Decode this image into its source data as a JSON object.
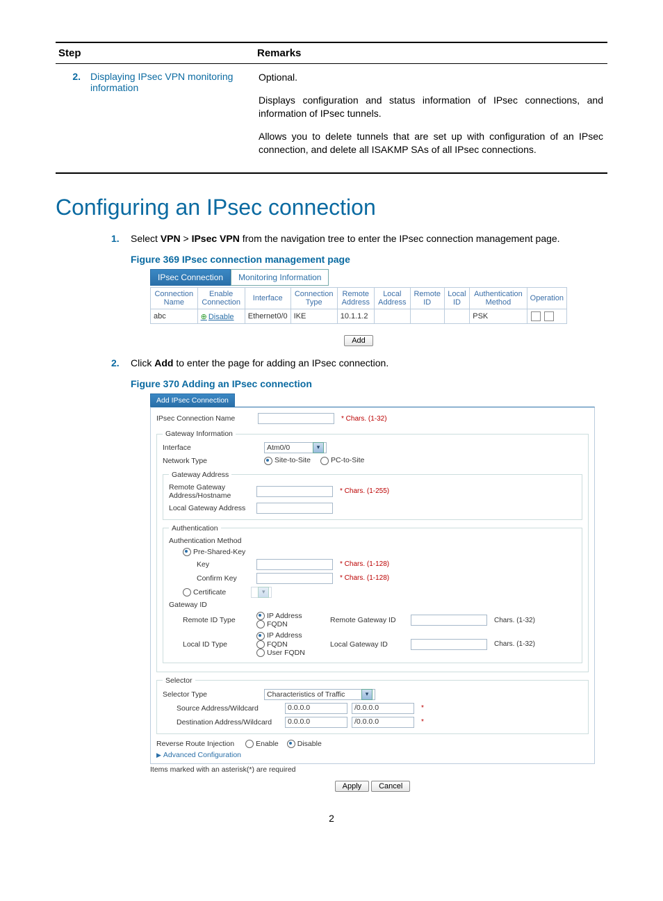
{
  "step_table": {
    "headers": [
      "Step",
      "Remarks"
    ],
    "row": {
      "num": "2.",
      "link_text": "Displaying IPsec VPN monitoring information",
      "remarks": [
        "Optional.",
        "Displays configuration and status information of IPsec connections, and information of IPsec tunnels.",
        "Allows you to delete tunnels that are set up with configuration of an IPsec connection, and delete all ISAKMP SAs of all IPsec connections."
      ]
    }
  },
  "section_heading": "Configuring an IPsec connection",
  "instructions": [
    {
      "num": "1.",
      "pre": "Select ",
      "b1": "VPN",
      "sep": " > ",
      "b2": "IPsec VPN",
      "post": " from the navigation tree to enter the IPsec connection management page."
    },
    {
      "num": "2.",
      "pre": "Click ",
      "b1": "Add",
      "post": " to enter the page for adding an IPsec connection."
    }
  ],
  "fig369": {
    "caption": "Figure 369 IPsec connection management page",
    "tabs": [
      "IPsec Connection",
      "Monitoring Information"
    ],
    "headers": [
      "Connection Name",
      "Enable Connection",
      "Interface",
      "Connection Type",
      "Remote Address",
      "Local Address",
      "Remote ID",
      "Local ID",
      "Authentication Method",
      "Operation"
    ],
    "row": {
      "name": "abc",
      "enable": "Disable",
      "iface": "Ethernet0/0",
      "ctype": "IKE",
      "raddr": "10.1.1.2",
      "laddr": "",
      "rid": "",
      "lid": "",
      "auth": "PSK"
    },
    "add_button": "Add"
  },
  "fig370": {
    "caption": "Figure 370 Adding an IPsec connection",
    "tab_label": "Add IPsec Connection",
    "name_label": "IPsec Connection Name",
    "name_hint": "* Chars. (1-32)",
    "gw": {
      "legend": "Gateway Information",
      "iface_label": "Interface",
      "iface_value": "Atm0/0",
      "ntype_label": "Network Type",
      "ntype_opts": [
        "Site-to-Site",
        "PC-to-Site"
      ],
      "ga_legend": "Gateway Address",
      "rga_label": "Remote Gateway Address/Hostname",
      "rga_hint": "* Chars. (1-255)",
      "lga_label": "Local Gateway Address"
    },
    "auth": {
      "legend": "Authentication",
      "method_label": "Authentication Method",
      "psk": "Pre-Shared-Key",
      "key_label": "Key",
      "key_hint": "* Chars. (1-128)",
      "ckey_label": "Confirm Key",
      "ckey_hint": "* Chars. (1-128)",
      "cert": "Certificate",
      "gid_label": "Gateway ID",
      "rid_label": "Remote ID Type",
      "rid_opts": [
        "IP Address",
        "FQDN"
      ],
      "rid_field": "Remote Gateway ID",
      "rid_hint": "Chars. (1-32)",
      "lid_label": "Local ID Type",
      "lid_opts": [
        "IP Address",
        "FQDN",
        "User FQDN"
      ],
      "lid_field": "Local Gateway ID",
      "lid_hint": "Chars. (1-32)"
    },
    "selector": {
      "legend": "Selector",
      "type_label": "Selector Type",
      "type_value": "Characteristics of Traffic",
      "src_label": "Source Address/Wildcard",
      "src_a": "0.0.0.0",
      "src_b": "/0.0.0.0",
      "dst_label": "Destination Address/Wildcard",
      "dst_a": "0.0.0.0",
      "dst_b": "/0.0.0.0"
    },
    "rri_label": "Reverse Route Injection",
    "rri_opts": [
      "Enable",
      "Disable"
    ],
    "adv": "Advanced Configuration",
    "footnote": "Items marked with an asterisk(*) are required",
    "buttons": [
      "Apply",
      "Cancel"
    ]
  },
  "page_number": "2"
}
